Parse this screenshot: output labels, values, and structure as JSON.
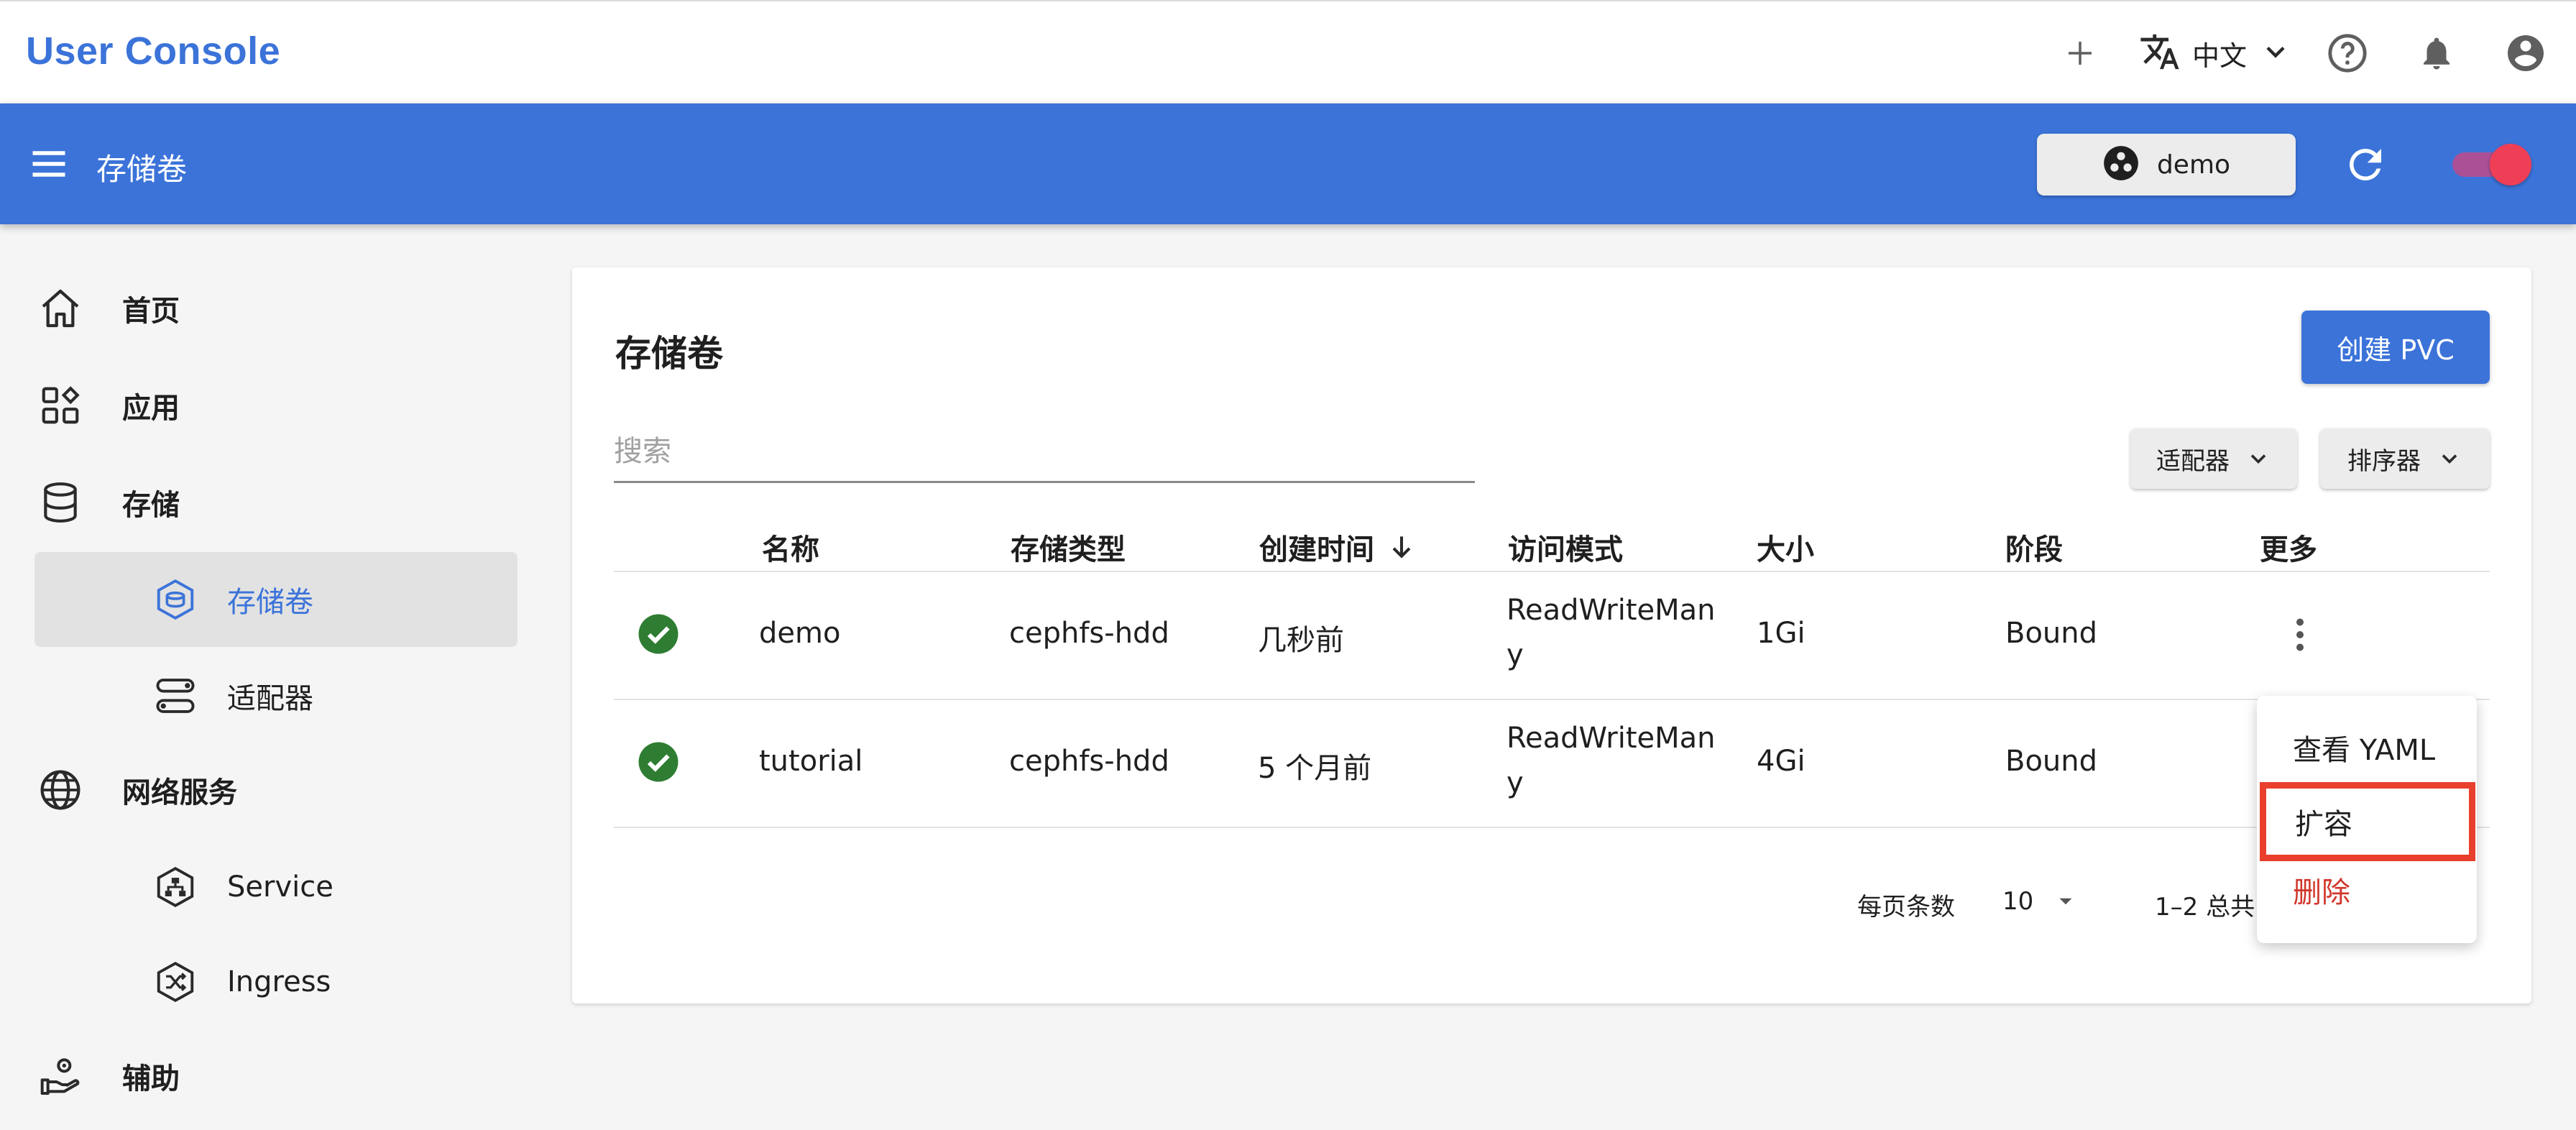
{
  "topbar": {
    "brand": "User Console",
    "language": "中文",
    "icons": [
      "add-icon",
      "translate-icon",
      "chevron-down-icon",
      "help-icon",
      "bell-icon",
      "account-icon"
    ]
  },
  "appbar": {
    "title": "存储卷",
    "namespace": "demo",
    "background": "#3b73d9",
    "toggle_color": "#ef3f56"
  },
  "sidebar": {
    "items": [
      {
        "label": "首页",
        "icon": "home-icon"
      },
      {
        "label": "应用",
        "icon": "apps-icon"
      },
      {
        "label": "存储",
        "icon": "database-icon"
      },
      {
        "label": "存储卷",
        "icon": "volume-icon",
        "active": true
      },
      {
        "label": "适配器",
        "icon": "adapter-icon"
      },
      {
        "label": "网络服务",
        "icon": "globe-icon"
      },
      {
        "label": "Service",
        "icon": "service-icon"
      },
      {
        "label": "Ingress",
        "icon": "ingress-icon"
      },
      {
        "label": "辅助",
        "icon": "support-icon"
      }
    ]
  },
  "main": {
    "title": "存储卷",
    "create_button": "创建 PVC",
    "search_placeholder": "搜索",
    "filter_button": "适配器",
    "sort_button": "排序器",
    "columns": [
      "名称",
      "存储类型",
      "创建时间",
      "访问模式",
      "大小",
      "阶段",
      "更多"
    ],
    "sort_icon": "arrow-down-icon",
    "rows": [
      {
        "name": "demo",
        "storage_class": "cephfs-hdd",
        "created": "几秒前",
        "access_mode_line1": "ReadWriteMan",
        "access_mode_line2": "y",
        "size": "1Gi",
        "phase": "Bound",
        "status_icon": "check-circle-icon"
      },
      {
        "name": "tutorial",
        "storage_class": "cephfs-hdd",
        "created": "5 个月前",
        "access_mode_line1": "ReadWriteMan",
        "access_mode_line2": "y",
        "size": "4Gi",
        "phase": "Bound",
        "status_icon": "check-circle-icon"
      }
    ],
    "pager": {
      "rows_per_page_label": "每页条数",
      "rows_per_page": "10",
      "range": "1–2 总共"
    }
  },
  "context_menu": {
    "items": [
      {
        "label": "查看 YAML"
      },
      {
        "label": "扩容",
        "highlighted": true
      },
      {
        "label": "删除",
        "danger": true
      }
    ],
    "highlight_color": "#e8402d",
    "danger_color": "#d1362b"
  }
}
